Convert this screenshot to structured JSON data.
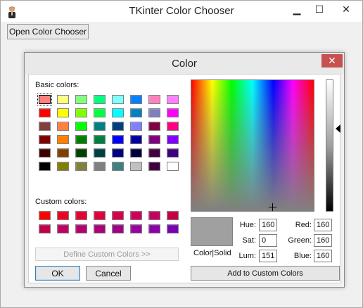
{
  "window": {
    "title": "TKinter Color Chooser",
    "open_button": "Open Color Chooser",
    "minimize": "▁",
    "maximize": "☐",
    "close": "✕"
  },
  "dialog": {
    "title": "Color",
    "close": "✕",
    "basic_label": "Basic colors:",
    "custom_label": "Custom colors:",
    "define_button": "Define Custom Colors >>",
    "ok": "OK",
    "cancel": "Cancel",
    "add_button": "Add to Custom Colors",
    "color_solid": "Color|Solid",
    "preview_color": "#a0a0a0",
    "hue_label": "Hue:",
    "hue": "160",
    "sat_label": "Sat:",
    "sat": "0",
    "lum_label": "Lum:",
    "lum": "151",
    "red_label": "Red:",
    "red": "160",
    "green_label": "Green:",
    "green": "160",
    "blue_label": "Blue:",
    "blue": "160",
    "basic_colors": [
      [
        "#ff8080",
        "#ffff80",
        "#80ff80",
        "#00ff80",
        "#80ffff",
        "#0080ff",
        "#ff80c0",
        "#ff80ff"
      ],
      [
        "#ff0000",
        "#ffff00",
        "#80ff00",
        "#00ff40",
        "#00ffff",
        "#0080c0",
        "#8080c0",
        "#ff00ff"
      ],
      [
        "#804040",
        "#ff8040",
        "#00ff00",
        "#008080",
        "#004080",
        "#8080ff",
        "#800040",
        "#ff0080"
      ],
      [
        "#800000",
        "#ff8000",
        "#008000",
        "#008040",
        "#0000ff",
        "#0000a0",
        "#800080",
        "#8000ff"
      ],
      [
        "#400000",
        "#804000",
        "#004000",
        "#004040",
        "#000080",
        "#000040",
        "#400040",
        "#400080"
      ],
      [
        "#000000",
        "#808000",
        "#808040",
        "#808080",
        "#408080",
        "#c0c0c0",
        "#400040",
        "#ffffff"
      ]
    ],
    "custom_colors": [
      [
        "#ff0000",
        "#ee0020",
        "#e40030",
        "#e0003a",
        "#d80048",
        "#d0005a",
        "#c40060",
        "#c80040"
      ],
      [
        "#c00048",
        "#c00060",
        "#b4006e",
        "#aa0078",
        "#a00088",
        "#9a00a0",
        "#8c00aa",
        "#7a00b4"
      ]
    ]
  }
}
